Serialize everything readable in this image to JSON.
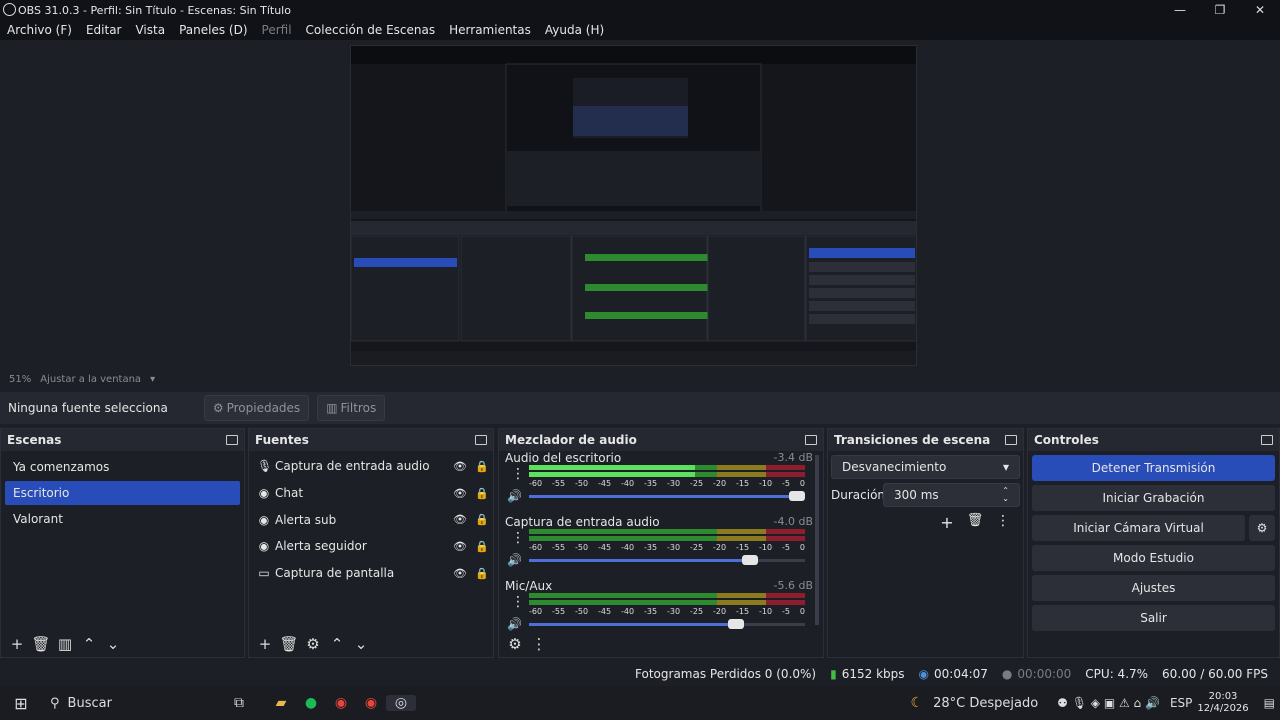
{
  "window": {
    "title": "OBS 31.0.3 - Perfil: Sin Título - Escenas: Sin Título",
    "min": "—",
    "max": "❐",
    "close": "✕"
  },
  "menu": [
    "Archivo (F)",
    "Editar",
    "Vista",
    "Paneles (D)",
    "Perfil",
    "Colección de Escenas",
    "Herramientas",
    "Ayuda (H)"
  ],
  "zoom": {
    "pct": "51%",
    "fit": "Ajustar a la ventana"
  },
  "sourcebar": {
    "no_source": "Ninguna fuente selecciona",
    "properties": "Propiedades",
    "filters": "Filtros"
  },
  "scenes": {
    "title": "Escenas",
    "items": [
      "Ya comenzamos",
      "Escritorio",
      "Valorant"
    ],
    "selected": 1
  },
  "sources": {
    "title": "Fuentes",
    "items": [
      {
        "label": "Captura de entrada audio",
        "icon": "microphone-icon"
      },
      {
        "label": "Chat",
        "icon": "browser-icon"
      },
      {
        "label": "Alerta sub",
        "icon": "browser-icon"
      },
      {
        "label": "Alerta seguidor",
        "icon": "browser-icon"
      },
      {
        "label": "Captura de pantalla",
        "icon": "monitor-icon"
      }
    ]
  },
  "mixer": {
    "title": "Mezclador de audio",
    "ticks": [
      "-60",
      "-55",
      "-50",
      "-45",
      "-40",
      "-35",
      "-30",
      "-25",
      "-20",
      "-15",
      "-10",
      "-5",
      "0"
    ],
    "channels": [
      {
        "name": "Audio del escritorio",
        "db": "-3.4 dB",
        "level": 0.6,
        "volume": 0.97
      },
      {
        "name": "Captura de entrada audio",
        "db": "-4.0 dB",
        "level": 0.0,
        "volume": 0.8
      },
      {
        "name": "Mic/Aux",
        "db": "-5.6 dB",
        "level": 0.0,
        "volume": 0.75
      }
    ]
  },
  "transitions": {
    "title": "Transiciones de escena",
    "selected": "Desvanecimiento",
    "duration_label": "Duración",
    "duration_value": "300 ms"
  },
  "controls": {
    "title": "Controles",
    "buttons": [
      "Detener Transmisión",
      "Iniciar Grabación",
      "Iniciar Cámara Virtual",
      "Modo Estudio",
      "Ajustes",
      "Salir"
    ]
  },
  "status": {
    "dropped": "Fotogramas Perdidos 0 (0.0%)",
    "bitrate": "6152 kbps",
    "stream_time": "00:04:07",
    "rec_time": "00:00:00",
    "cpu": "CPU: 4.7%",
    "fps": "60.00 / 60.00 FPS"
  },
  "taskbar": {
    "search": "Buscar",
    "weather": "28°C Despejado",
    "lang": "ESP",
    "time": "20:03",
    "date": "12/4/2026"
  },
  "colors": {
    "accent": "#284cb8",
    "meter_green": "#2e8a2e",
    "meter_yellow": "#8c7a1e",
    "meter_red": "#8c1e2e"
  }
}
